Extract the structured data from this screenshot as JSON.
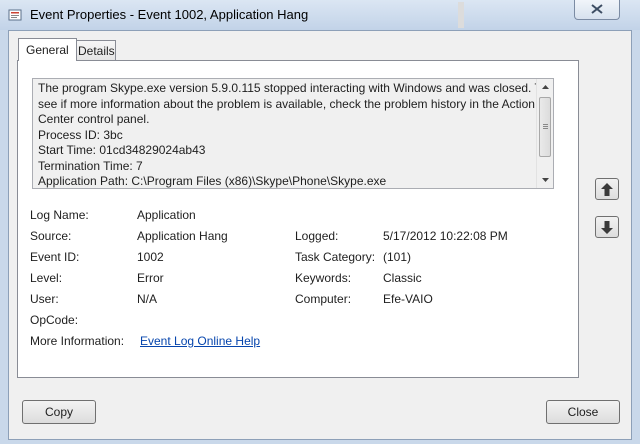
{
  "window": {
    "title": "Event Properties - Event 1002, Application Hang"
  },
  "tabs": [
    {
      "label": "General"
    },
    {
      "label": "Details"
    }
  ],
  "description": {
    "lines": [
      "The program Skype.exe version 5.9.0.115 stopped interacting with Windows and was closed. To",
      "see if more information about the problem is available, check the problem history in the Action",
      "Center control panel.",
      " Process ID: 3bc",
      " Start Time: 01cd34829024ab43",
      " Termination Time: 7",
      " Application Path: C:\\Program Files (x86)\\Skype\\Phone\\Skype.exe"
    ]
  },
  "fields": {
    "log_name": {
      "label": "Log Name:",
      "value": "Application"
    },
    "source": {
      "label": "Source:",
      "value": "Application Hang"
    },
    "logged": {
      "label": "Logged:",
      "value": "5/17/2012 10:22:08 PM"
    },
    "event_id": {
      "label": "Event ID:",
      "value": "1002"
    },
    "task_category": {
      "label": "Task Category:",
      "value": "(101)"
    },
    "level": {
      "label": "Level:",
      "value": "Error"
    },
    "keywords": {
      "label": "Keywords:",
      "value": "Classic"
    },
    "user": {
      "label": "User:",
      "value": "N/A"
    },
    "computer": {
      "label": "Computer:",
      "value": "Efe-VAIO"
    },
    "opcode": {
      "label": "OpCode:",
      "value": ""
    },
    "more_info": {
      "label": "More Information:",
      "link": "Event Log Online Help"
    }
  },
  "buttons": {
    "copy": "Copy",
    "close": "Close"
  },
  "icons": {
    "close": "close-icon",
    "up": "arrow-up-icon",
    "down": "arrow-down-icon",
    "app": "event-viewer-icon"
  },
  "colors": {
    "link": "#0645ad",
    "frame": "#c9d8ea"
  }
}
